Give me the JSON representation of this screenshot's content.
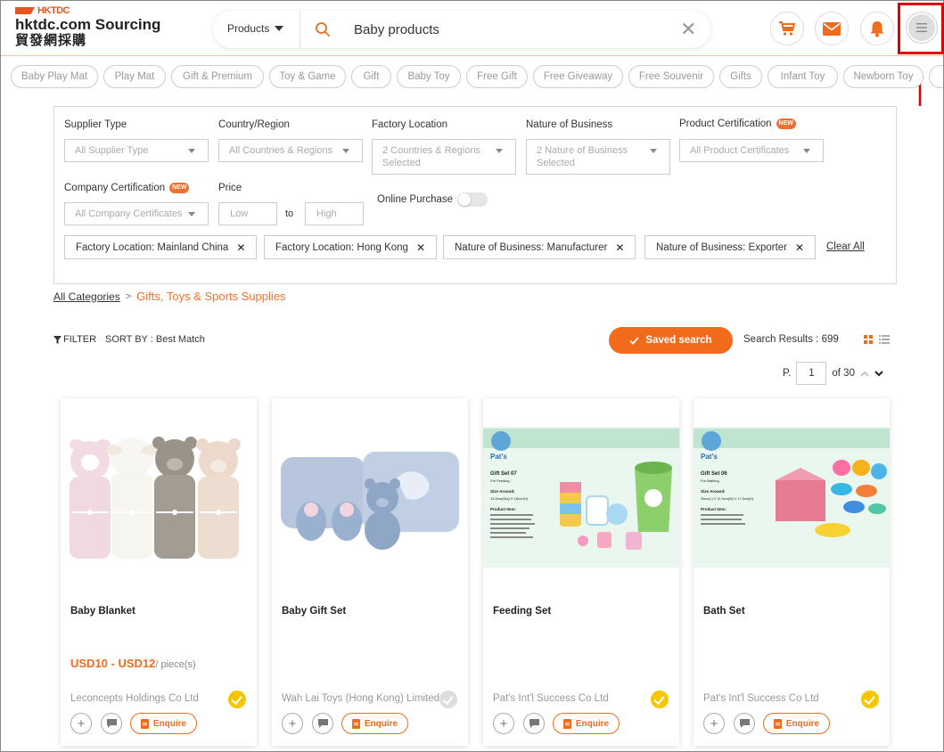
{
  "header": {
    "logo_brand": "HKTDC",
    "logo_title": "hktdc.com Sourcing",
    "logo_subtitle": "貿發網採購",
    "search_category": "Products",
    "search_value": "Baby products",
    "clear_symbol": "✕",
    "icons": [
      "cart-icon",
      "mail-icon",
      "bell-icon",
      "hamburger-menu-icon"
    ],
    "accent_color": "#f26a1b"
  },
  "chips": [
    "Baby Play Mat",
    "Play Mat",
    "Gift & Premium",
    "Toy & Game",
    "Gift",
    "Baby Toy",
    "Free Gift",
    "Free Giveaway",
    "Free Souvenir",
    "Gifts",
    "Infant Toy",
    "Newborn Toy"
  ],
  "filters": {
    "supplier_type": {
      "label": "Supplier Type",
      "value": "All Supplier Type"
    },
    "country": {
      "label": "Country/Region",
      "value": "All Countries & Regions"
    },
    "factory": {
      "label": "Factory Location",
      "value_line1": "2 Countries & Regions",
      "value_line2": "Selected"
    },
    "nature": {
      "label": "Nature of Business",
      "value_line1": "2 Nature of Business",
      "value_line2": "Selected"
    },
    "product_cert": {
      "label": "Product Certification",
      "value": "All Product Certificates",
      "badge": "NEW"
    },
    "company_cert": {
      "label": "Company Certification",
      "value": "All Company Certificates",
      "badge": "NEW"
    },
    "price": {
      "label": "Price",
      "low_placeholder": "Low",
      "to": "to",
      "high_placeholder": "High"
    },
    "online_purchase": {
      "label": "Online Purchase",
      "enabled": false
    },
    "active_tags": [
      "Factory Location: Mainland China",
      "Factory Location: Hong Kong",
      "Nature of Business: Manufacturer",
      "Nature of Business: Exporter"
    ],
    "clear_all": "Clear All",
    "remove_symbol": "✕"
  },
  "breadcrumb": {
    "root": "All Categories",
    "sep": ">",
    "current": "Gifts, Toys & Sports Supplies"
  },
  "toolbar": {
    "filter": "FILTER",
    "sort": "SORT BY : Best Match",
    "saved_search": "Saved search",
    "results": "Search Results : 699",
    "page_label": "P.",
    "page_value": "1",
    "page_total": "of 30",
    "up": "^",
    "down": "⌄"
  },
  "products": [
    {
      "name": "Baby Blanket",
      "price": "USD10 - USD12",
      "unit": "/ piece(s)",
      "supplier": "Leconcepts Holdings Co Ltd",
      "verified": "gold",
      "enquire": "Enquire"
    },
    {
      "name": "Baby Gift Set",
      "price": "",
      "unit": "",
      "supplier": "Wah Lai Toys (Hong Kong) Limited",
      "verified": "grey",
      "enquire": "Enquire"
    },
    {
      "name": "Feeding Set",
      "price": "",
      "unit": "",
      "supplier": "Pat's Int'l Success Co Ltd",
      "verified": "gold",
      "enquire": "Enquire"
    },
    {
      "name": "Bath Set",
      "price": "",
      "unit": "",
      "supplier": "Pat's Int'l Success Co Ltd",
      "verified": "gold",
      "enquire": "Enquire"
    }
  ],
  "product_images": {
    "feeding": {
      "brand": "Pat's",
      "title": "Gift Set 07",
      "subtitle": "For Feeding",
      "size_label": "Size Around:",
      "size": "14.5cm(Dia) X 18cm(H)",
      "items_label": "Product Item:"
    },
    "bath": {
      "brand": "Pat's",
      "title": "Gift Set 06",
      "subtitle": "For Bathing",
      "size_label": "Size Around:",
      "size": "33cm(L) X 11.5cm(W) X 17.5cm(H)",
      "items_label": "Product Item:"
    }
  }
}
